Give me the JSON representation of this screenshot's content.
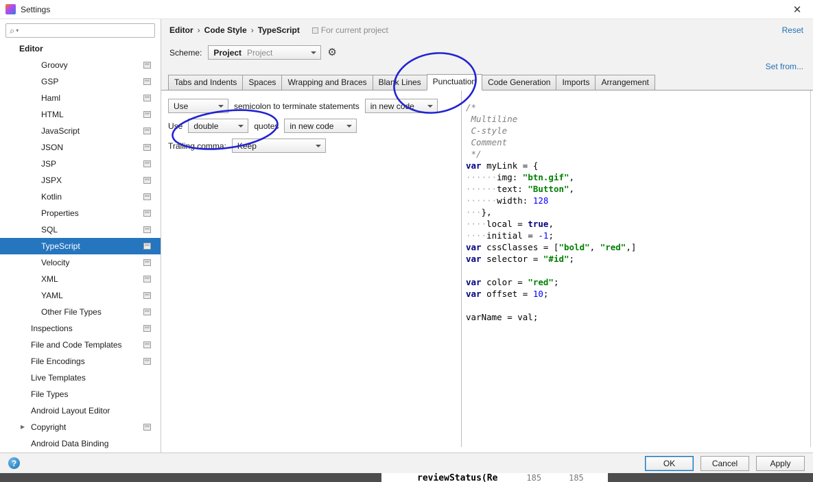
{
  "window": {
    "title": "Settings"
  },
  "icons": {
    "close": "✕",
    "search": "⌕",
    "chevron_small": "▾",
    "gear": "⚙",
    "arrow_right": "▶",
    "help": "?"
  },
  "sidebar": {
    "search_placeholder": "",
    "items": [
      {
        "label": "Editor",
        "level": 0,
        "icon": false
      },
      {
        "label": "Groovy",
        "level": 2,
        "icon": true
      },
      {
        "label": "GSP",
        "level": 2,
        "icon": true
      },
      {
        "label": "Haml",
        "level": 2,
        "icon": true
      },
      {
        "label": "HTML",
        "level": 2,
        "icon": true
      },
      {
        "label": "JavaScript",
        "level": 2,
        "icon": true
      },
      {
        "label": "JSON",
        "level": 2,
        "icon": true
      },
      {
        "label": "JSP",
        "level": 2,
        "icon": true
      },
      {
        "label": "JSPX",
        "level": 2,
        "icon": true
      },
      {
        "label": "Kotlin",
        "level": 2,
        "icon": true
      },
      {
        "label": "Properties",
        "level": 2,
        "icon": true
      },
      {
        "label": "SQL",
        "level": 2,
        "icon": true
      },
      {
        "label": "TypeScript",
        "level": 2,
        "icon": true,
        "selected": true
      },
      {
        "label": "Velocity",
        "level": 2,
        "icon": true
      },
      {
        "label": "XML",
        "level": 2,
        "icon": true
      },
      {
        "label": "YAML",
        "level": 2,
        "icon": true
      },
      {
        "label": "Other File Types",
        "level": 2,
        "icon": true
      },
      {
        "label": "Inspections",
        "level": 1,
        "icon": true
      },
      {
        "label": "File and Code Templates",
        "level": 1,
        "icon": true
      },
      {
        "label": "File Encodings",
        "level": 1,
        "icon": true
      },
      {
        "label": "Live Templates",
        "level": 1,
        "icon": false
      },
      {
        "label": "File Types",
        "level": 1,
        "icon": false
      },
      {
        "label": "Android Layout Editor",
        "level": 1,
        "icon": false
      },
      {
        "label": "Copyright",
        "level": 1,
        "icon": true,
        "arrow": true
      },
      {
        "label": "Android Data Binding",
        "level": 1,
        "icon": false
      }
    ]
  },
  "header": {
    "breadcrumb": [
      "Editor",
      "Code Style",
      "TypeScript"
    ],
    "separator": "›",
    "context_note": "For current project",
    "reset": "Reset",
    "scheme_label": "Scheme:",
    "scheme_value": "Project",
    "scheme_hint": "Project",
    "set_from": "Set from..."
  },
  "tabs": {
    "items": [
      "Tabs and Indents",
      "Spaces",
      "Wrapping and Braces",
      "Blank Lines",
      "Punctuation",
      "Code Generation",
      "Imports",
      "Arrangement"
    ],
    "selected_index": 4
  },
  "options": {
    "row1": {
      "combo1": "Use",
      "text": "semicolon to terminate statements",
      "combo2": "in new code"
    },
    "row2": {
      "prefix": "Use",
      "combo1": "double",
      "middle": "quotes",
      "combo2": "in new code"
    },
    "row3": {
      "label": "Trailing comma:",
      "combo": "Keep"
    }
  },
  "preview": {
    "lines": [
      [
        [
          "com",
          "/*"
        ]
      ],
      [
        [
          "com",
          " Multiline"
        ]
      ],
      [
        [
          "com",
          " C-style"
        ]
      ],
      [
        [
          "com",
          " Comment"
        ]
      ],
      [
        [
          "com",
          " */"
        ]
      ],
      [
        [
          "kw",
          "var"
        ],
        [
          "pl",
          " myLink = {"
        ]
      ],
      [
        [
          "ws",
          "······"
        ],
        [
          "pl",
          "img: "
        ],
        [
          "str",
          "\"btn.gif\""
        ],
        [
          "pl",
          ","
        ]
      ],
      [
        [
          "ws",
          "······"
        ],
        [
          "pl",
          "text: "
        ],
        [
          "str",
          "\"Button\""
        ],
        [
          "pl",
          ","
        ]
      ],
      [
        [
          "ws",
          "······"
        ],
        [
          "pl",
          "width: "
        ],
        [
          "num",
          "128"
        ]
      ],
      [
        [
          "ws",
          "···"
        ],
        [
          "pl",
          "},"
        ]
      ],
      [
        [
          "ws",
          "····"
        ],
        [
          "pl",
          "local = "
        ],
        [
          "kw",
          "true"
        ],
        [
          "pl",
          ","
        ]
      ],
      [
        [
          "ws",
          "····"
        ],
        [
          "pl",
          "initial = "
        ],
        [
          "num",
          "-1"
        ],
        [
          "pl",
          ";"
        ]
      ],
      [
        [
          "kw",
          "var"
        ],
        [
          "pl",
          " cssClasses = ["
        ],
        [
          "str",
          "\"bold\""
        ],
        [
          "pl",
          ", "
        ],
        [
          "str",
          "\"red\""
        ],
        [
          "pl",
          ",]"
        ]
      ],
      [
        [
          "kw",
          "var"
        ],
        [
          "pl",
          " selector = "
        ],
        [
          "str",
          "\"#id\""
        ],
        [
          "pl",
          ";"
        ]
      ],
      [],
      [
        [
          "kw",
          "var"
        ],
        [
          "pl",
          " color = "
        ],
        [
          "str",
          "\"red\""
        ],
        [
          "pl",
          ";"
        ]
      ],
      [
        [
          "kw",
          "var"
        ],
        [
          "pl",
          " offset = "
        ],
        [
          "num",
          "10"
        ],
        [
          "pl",
          ";"
        ]
      ],
      [],
      [
        [
          "pl",
          "varName = val;"
        ]
      ]
    ]
  },
  "footer": {
    "ok": "OK",
    "cancel": "Cancel",
    "apply": "Apply"
  },
  "background_app": {
    "text": "reviewStatus(Re",
    "col1": "185",
    "col2": "185"
  },
  "colors": {
    "selection": "#2675bf",
    "link": "#2470b3",
    "annotation": "#2323d2",
    "keyword": "#000080",
    "string": "#008000",
    "number": "#0000ff",
    "comment": "#808080"
  }
}
